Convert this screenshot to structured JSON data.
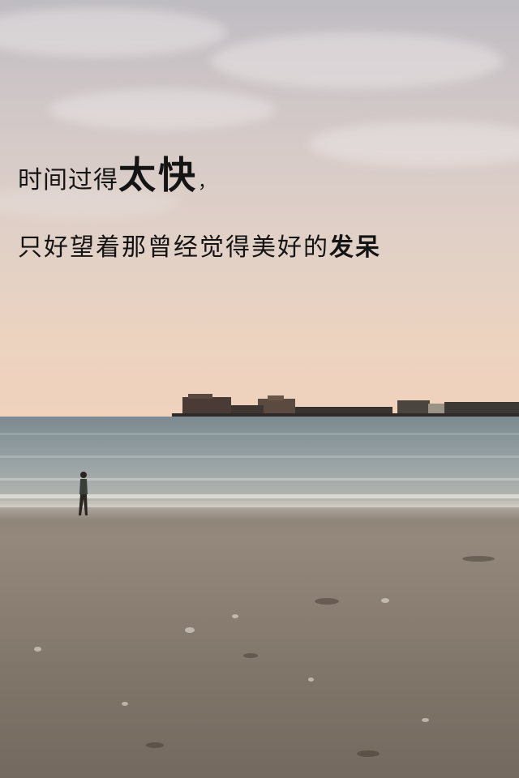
{
  "caption": {
    "line1_prefix": "时间过得",
    "line1_emphasis": "太快",
    "line1_suffix": "，",
    "line2_prefix": "只好望着那曾经觉得美好的",
    "line2_emphasis": "发呆"
  },
  "colors": {
    "text": "#141414",
    "sky_top": "#bfbcc2",
    "sky_horizon": "#f0d2bd",
    "sea": "#7c8a91",
    "sand": "#8b7f73"
  }
}
